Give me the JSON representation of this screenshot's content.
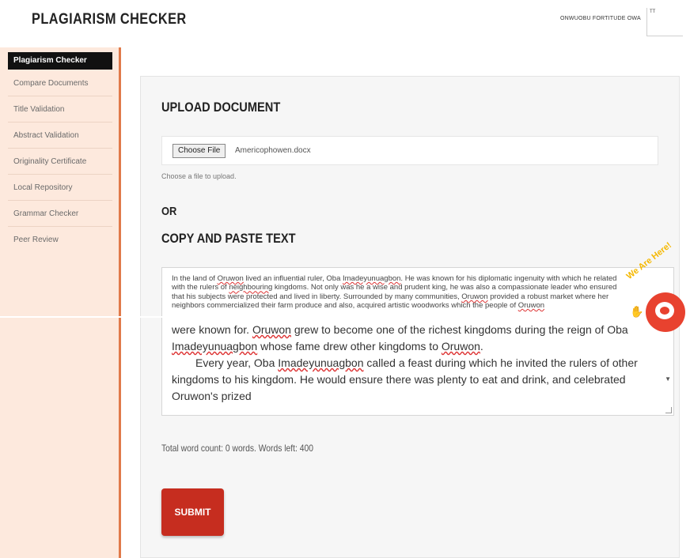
{
  "header": {
    "title": "PLAGIARISM CHECKER",
    "user_name": "ONWUOBU FORTITUDE OWA",
    "box_label": "TT"
  },
  "sidebar": {
    "items": [
      {
        "label": "Plagiarism Checker",
        "active": true
      },
      {
        "label": "Compare Documents"
      },
      {
        "label": "Title Validation"
      },
      {
        "label": "Abstract Validation"
      },
      {
        "label": "Originality Certificate"
      },
      {
        "label": "Local Repository"
      },
      {
        "label": "Grammar Checker"
      },
      {
        "label": "Peer Review"
      }
    ]
  },
  "main": {
    "upload_heading": "UPLOAD DOCUMENT",
    "file_button": "Choose File",
    "file_name": "Americophowen.docx",
    "file_help": "Choose a file to upload.",
    "or": "OR",
    "paste_heading": "COPY AND PASTE TEXT",
    "text_small": [
      "In the land of ",
      "Oruwon",
      " lived an influential ruler, Oba ",
      "Imadeyunuagbon",
      ". He was known for his diplomatic ingenuity with which he related with the rulers of ",
      "neighbouring",
      " kingdoms. Not only was he a wise and prudent king, he was also a compassionate leader who ensured that his subjects were protected and lived in liberty. Surrounded by many communities, ",
      "Oruwon",
      " provided a robust market where her neighbors commercialized their farm produce and also, acquired artistic woodworks which the people of ",
      "Oruwon"
    ],
    "text_large_p1": [
      "were known for. ",
      "Oruwon",
      " grew to become one of the richest kingdoms during the reign of Oba ",
      "Imadeyunuagbon",
      " whose fame drew other kingdoms to ",
      "Oruwon",
      "."
    ],
    "text_large_p2": [
      "Every year, Oba ",
      "Imadeyunuagbon",
      " called a feast during which he invited the rulers of other kingdoms to his kingdom. He would ensure there was plenty to eat and drink, and celebrated Oruwon's prized"
    ],
    "word_count": "Total word count: 0 words. Words left: 400",
    "submit": "SUBMIT"
  },
  "chat_widget": {
    "text": "We Are Here!",
    "accent": "#e8422f",
    "text_color": "#f5b800"
  },
  "colors": {
    "sidebar_bg": "#fde9dd",
    "sidebar_border": "#e07a4a",
    "submit_bg": "#c62d1f"
  }
}
